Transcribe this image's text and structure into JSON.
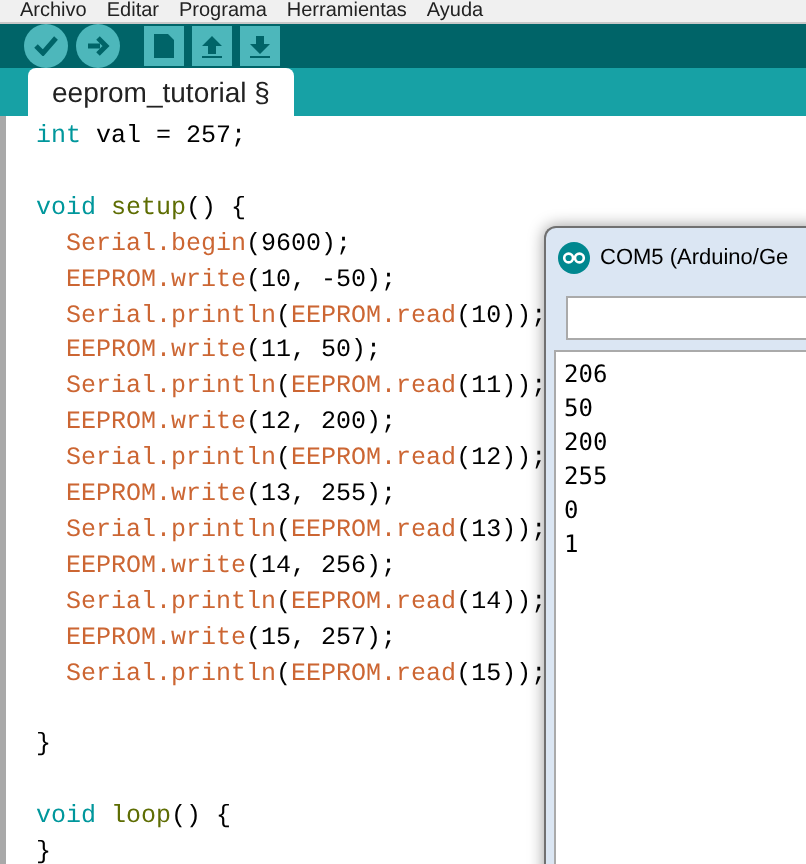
{
  "menu_bar": [
    "Archivo",
    "Editar",
    "Programa",
    "Herramientas",
    "Ayuda"
  ],
  "toolbar": [
    {
      "kind": "verify"
    },
    {
      "kind": "upload"
    },
    {
      "kind": "new"
    },
    {
      "kind": "open"
    },
    {
      "kind": "save"
    }
  ],
  "tabs": [
    {
      "label": "eeprom_tutorial §",
      "selected": true
    }
  ],
  "code_lines": [
    {
      "indent": false,
      "blank_before": false,
      "tokens": [
        {
          "kind": "type",
          "text": "int"
        },
        {
          "kind": "plain",
          "text": " val = 257;"
        }
      ]
    },
    {
      "indent": false,
      "blank_before": true,
      "tokens": [
        {
          "kind": "type",
          "text": "void "
        },
        {
          "kind": "func",
          "text": "setup"
        },
        {
          "kind": "plain",
          "text": "() {"
        }
      ]
    },
    {
      "indent": true,
      "blank_before": false,
      "tokens": [
        {
          "kind": "lib",
          "text": "Serial.begin"
        },
        {
          "kind": "plain",
          "text": "(9600);"
        }
      ]
    },
    {
      "indent": true,
      "blank_before": false,
      "tokens": [
        {
          "kind": "lib",
          "text": "EEPROM.write"
        },
        {
          "kind": "plain",
          "text": "(10, -50);"
        }
      ]
    },
    {
      "indent": true,
      "blank_before": false,
      "tokens": [
        {
          "kind": "lib",
          "text": "Serial.println"
        },
        {
          "kind": "plain",
          "text": "("
        },
        {
          "kind": "lib",
          "text": "EEPROM.read"
        },
        {
          "kind": "plain",
          "text": "(10));"
        }
      ]
    },
    {
      "indent": true,
      "blank_before": false,
      "tokens": [
        {
          "kind": "lib",
          "text": "EEPROM.write"
        },
        {
          "kind": "plain",
          "text": "(11, 50);"
        }
      ]
    },
    {
      "indent": true,
      "blank_before": false,
      "tokens": [
        {
          "kind": "lib",
          "text": "Serial.println"
        },
        {
          "kind": "plain",
          "text": "("
        },
        {
          "kind": "lib",
          "text": "EEPROM.read"
        },
        {
          "kind": "plain",
          "text": "(11));"
        }
      ]
    },
    {
      "indent": true,
      "blank_before": false,
      "tokens": [
        {
          "kind": "lib",
          "text": "EEPROM.write"
        },
        {
          "kind": "plain",
          "text": "(12, 200);"
        }
      ]
    },
    {
      "indent": true,
      "blank_before": false,
      "tokens": [
        {
          "kind": "lib",
          "text": "Serial.println"
        },
        {
          "kind": "plain",
          "text": "("
        },
        {
          "kind": "lib",
          "text": "EEPROM.read"
        },
        {
          "kind": "plain",
          "text": "(12));"
        }
      ]
    },
    {
      "indent": true,
      "blank_before": false,
      "tokens": [
        {
          "kind": "lib",
          "text": "EEPROM.write"
        },
        {
          "kind": "plain",
          "text": "(13, 255);"
        }
      ]
    },
    {
      "indent": true,
      "blank_before": false,
      "tokens": [
        {
          "kind": "lib",
          "text": "Serial.println"
        },
        {
          "kind": "plain",
          "text": "("
        },
        {
          "kind": "lib",
          "text": "EEPROM.read"
        },
        {
          "kind": "plain",
          "text": "(13));"
        }
      ]
    },
    {
      "indent": true,
      "blank_before": false,
      "tokens": [
        {
          "kind": "lib",
          "text": "EEPROM.write"
        },
        {
          "kind": "plain",
          "text": "(14, 256);"
        }
      ]
    },
    {
      "indent": true,
      "blank_before": false,
      "tokens": [
        {
          "kind": "lib",
          "text": "Serial.println"
        },
        {
          "kind": "plain",
          "text": "("
        },
        {
          "kind": "lib",
          "text": "EEPROM.read"
        },
        {
          "kind": "plain",
          "text": "(14));"
        }
      ]
    },
    {
      "indent": true,
      "blank_before": false,
      "tokens": [
        {
          "kind": "lib",
          "text": "EEPROM.write"
        },
        {
          "kind": "plain",
          "text": "(15, 257);"
        }
      ]
    },
    {
      "indent": true,
      "blank_before": false,
      "tokens": [
        {
          "kind": "lib",
          "text": "Serial.println"
        },
        {
          "kind": "plain",
          "text": "("
        },
        {
          "kind": "lib",
          "text": "EEPROM.read"
        },
        {
          "kind": "plain",
          "text": "(15));"
        }
      ]
    },
    {
      "indent": false,
      "blank_before": true,
      "tokens": [
        {
          "kind": "plain",
          "text": "}"
        }
      ]
    },
    {
      "indent": false,
      "blank_before": true,
      "tokens": [
        {
          "kind": "type",
          "text": "void "
        },
        {
          "kind": "func",
          "text": "loop"
        },
        {
          "kind": "plain",
          "text": "() {"
        }
      ]
    },
    {
      "indent": false,
      "blank_before": false,
      "tokens": [
        {
          "kind": "plain",
          "text": "}"
        }
      ]
    }
  ],
  "serial_monitor": {
    "title": "COM5 (Arduino/Ge",
    "output": [
      "206",
      "50",
      "200",
      "255",
      "0",
      "1"
    ]
  }
}
